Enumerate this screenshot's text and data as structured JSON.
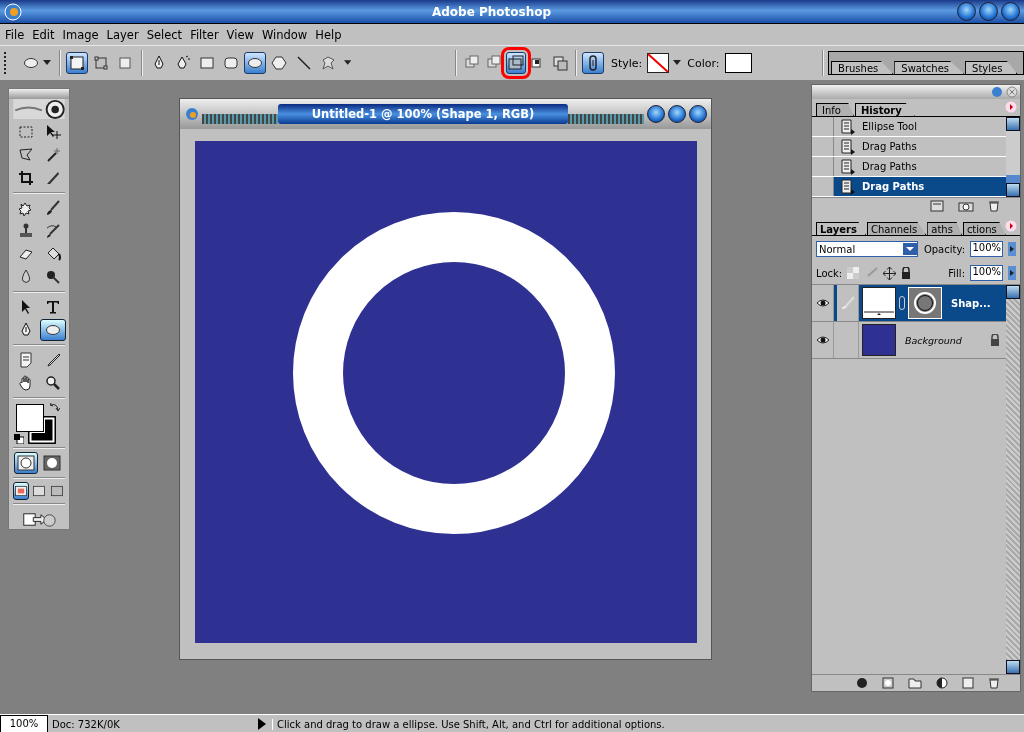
{
  "window": {
    "title": "Adobe Photoshop"
  },
  "menu": [
    "File",
    "Edit",
    "Image",
    "Layer",
    "Select",
    "Filter",
    "View",
    "Window",
    "Help"
  ],
  "options_bar": {
    "path_modes": [
      {
        "kind": "shape-layers",
        "selected": true
      },
      {
        "kind": "paths",
        "selected": false
      },
      {
        "kind": "fill-pixels",
        "selected": false
      }
    ],
    "shape_tools": [
      {
        "kind": "pen",
        "selected": false
      },
      {
        "kind": "freeform-pen",
        "selected": false
      },
      {
        "kind": "rectangle",
        "selected": false
      },
      {
        "kind": "rounded-rectangle",
        "selected": false
      },
      {
        "kind": "ellipse",
        "selected": true
      },
      {
        "kind": "polygon",
        "selected": false
      },
      {
        "kind": "line",
        "selected": false
      },
      {
        "kind": "custom-shape",
        "selected": false
      }
    ],
    "combine_modes": [
      {
        "kind": "add",
        "selected": false
      },
      {
        "kind": "add",
        "selected": false
      },
      {
        "kind": "subtract",
        "selected": true
      },
      {
        "kind": "intersect",
        "selected": false
      },
      {
        "kind": "exclude",
        "selected": false
      }
    ],
    "style_label": "Style:",
    "color_label": "Color:",
    "palette_tabs": [
      "Brushes",
      "Swatches",
      "Styles"
    ]
  },
  "toolbox": {
    "tool_groups": [
      {
        "tools": [
          {
            "kind": "marquee",
            "selected": false
          },
          {
            "kind": "move",
            "selected": false
          },
          {
            "kind": "lasso",
            "selected": false
          },
          {
            "kind": "magic-wand",
            "selected": false
          },
          {
            "kind": "crop",
            "selected": false
          },
          {
            "kind": "slice",
            "selected": false
          }
        ]
      },
      {
        "tools": [
          {
            "kind": "healing",
            "selected": false
          },
          {
            "kind": "brush",
            "selected": false
          },
          {
            "kind": "stamp",
            "selected": false
          },
          {
            "kind": "history-brush",
            "selected": false
          },
          {
            "kind": "eraser",
            "selected": false
          },
          {
            "kind": "bucket",
            "selected": false
          },
          {
            "kind": "blur",
            "selected": false
          },
          {
            "kind": "dodge",
            "selected": false
          }
        ]
      },
      {
        "tools": [
          {
            "kind": "path-select",
            "selected": false
          },
          {
            "kind": "type",
            "selected": false
          },
          {
            "kind": "pen",
            "selected": false
          },
          {
            "kind": "ellipse",
            "selected": true
          }
        ]
      },
      {
        "tools": [
          {
            "kind": "notes",
            "selected": false
          },
          {
            "kind": "eyedropper",
            "selected": false
          },
          {
            "kind": "hand",
            "selected": false
          },
          {
            "kind": "zoom",
            "selected": false
          }
        ]
      }
    ],
    "foreground": {
      "color": "#ffffff"
    },
    "background": {
      "color": "#000000"
    },
    "mask_modes": [
      {
        "kind": "standard",
        "selected": true
      },
      {
        "kind": "quick-mask",
        "selected": false
      }
    ],
    "screen_modes": [
      {
        "kind": "window",
        "selected": true
      },
      {
        "kind": "full-menu",
        "selected": false
      },
      {
        "kind": "full",
        "selected": false
      }
    ]
  },
  "document": {
    "title": "Untitled-1 @ 100% (Shape 1, RGB)"
  },
  "history": {
    "tabs": [
      {
        "label": "Info",
        "selected": false
      },
      {
        "label": "History",
        "selected": true
      }
    ],
    "states": [
      {
        "label": "Ellipse Tool",
        "selected": false
      },
      {
        "label": "Drag Paths",
        "selected": false
      },
      {
        "label": "Drag Paths",
        "selected": false
      },
      {
        "label": "Drag Paths",
        "selected": true
      }
    ]
  },
  "layers": {
    "tabs": [
      {
        "label": "Layers",
        "selected": true
      },
      {
        "label": "Channels",
        "selected": false
      },
      {
        "label": "aths",
        "selected": false
      },
      {
        "label": "ctions",
        "selected": false
      }
    ],
    "blend_mode": "Normal",
    "opacity_label": "Opacity:",
    "opacity": "100%",
    "lock_label": "Lock:",
    "fill_label": "Fill:",
    "fill": "100%",
    "items": [
      {
        "name": "Shap...",
        "kind": "shape",
        "selected": true,
        "visible": true,
        "locked": false
      },
      {
        "name": "Background",
        "kind": "background",
        "selected": false,
        "visible": true,
        "locked": true
      }
    ]
  },
  "status_bar": {
    "zoom": "100%",
    "doc": "Doc: 732K/0K",
    "hint": "Click and drag to draw a ellipse.  Use Shift, Alt, and Ctrl for additional options."
  }
}
